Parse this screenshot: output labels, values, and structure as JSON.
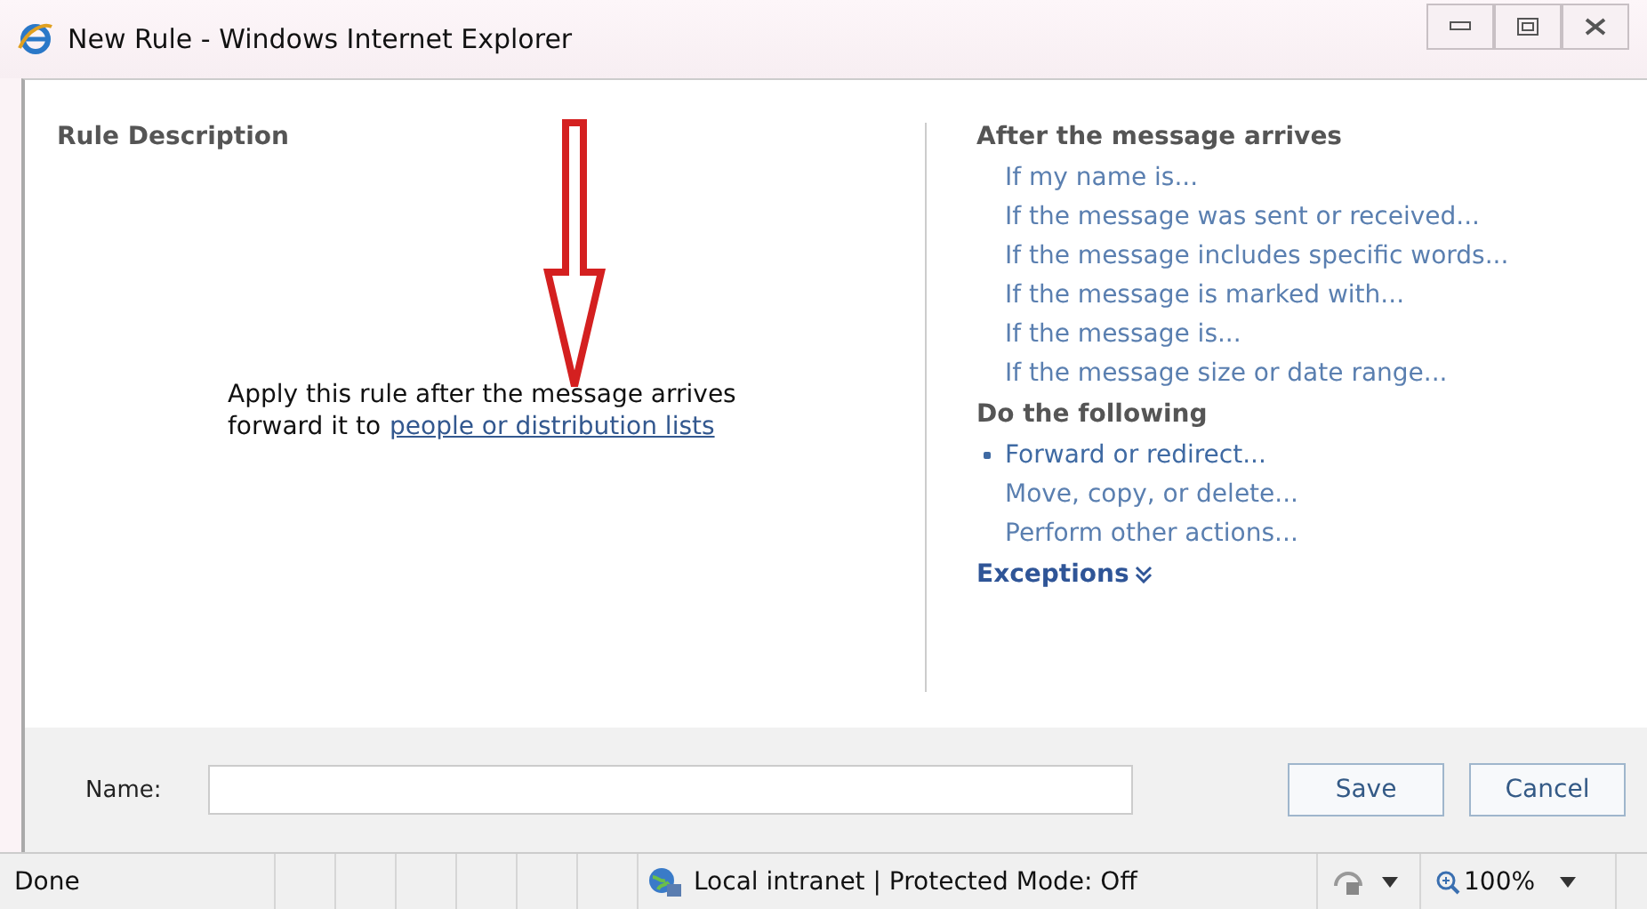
{
  "window": {
    "title": "New Rule - Windows Internet Explorer"
  },
  "rule_description": {
    "heading": "Rule Description",
    "line_1": "Apply this rule after the message arrives",
    "line_2_prefix": "forward it to",
    "line_2_link": "people or distribution lists"
  },
  "conditions": {
    "heading": "After the message arrives",
    "items": [
      "If my name is...",
      "If the message was sent or received...",
      "If the message includes specific words...",
      "If the message is marked with...",
      "If the message is...",
      "If the message size or date range..."
    ]
  },
  "actions": {
    "heading": "Do the following",
    "items": [
      {
        "label": "Forward or redirect...",
        "selected": true
      },
      {
        "label": "Move, copy, or delete...",
        "selected": false
      },
      {
        "label": "Perform other actions...",
        "selected": false
      }
    ]
  },
  "exceptions": {
    "label": "Exceptions",
    "expanded": false
  },
  "name_field": {
    "label": "Name:"
  },
  "buttons": [
    "Save",
    "Cancel"
  ],
  "status_bar": {
    "status": "Done",
    "zone": "Local intranet | Protected Mode: Off",
    "zoom": "100%"
  }
}
